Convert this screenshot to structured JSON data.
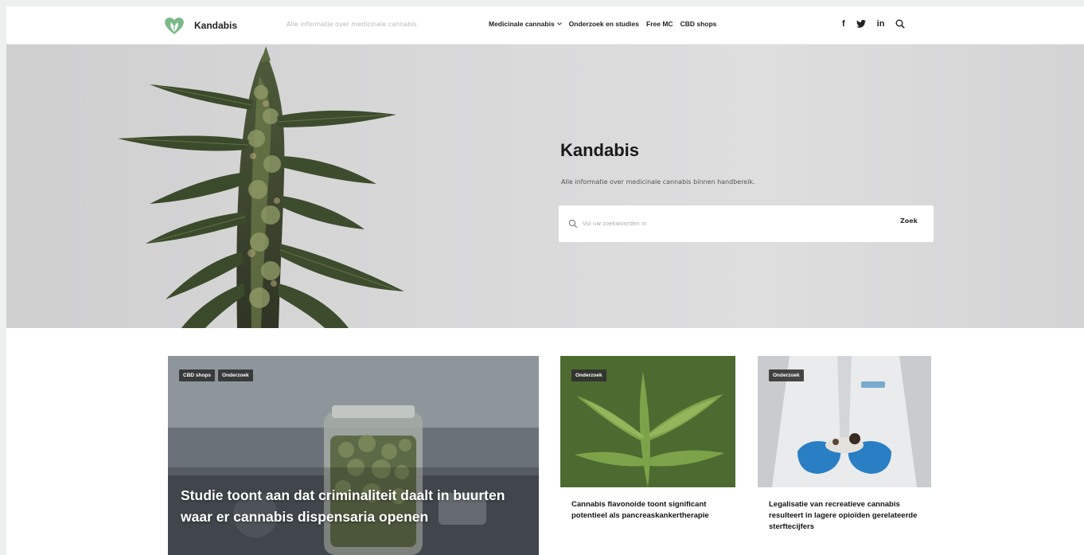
{
  "site": {
    "name": "Kandabis",
    "tagline": "Alle informatie over medicinale cannabis",
    "brand_color": "#6fae7c"
  },
  "nav": {
    "items": [
      {
        "label": "Medicinale cannabis",
        "has_dropdown": true
      },
      {
        "label": "Onderzoek en studies",
        "has_dropdown": false
      },
      {
        "label": "Free MC",
        "has_dropdown": false
      },
      {
        "label": "CBD shops",
        "has_dropdown": false
      }
    ]
  },
  "social": {
    "facebook": "f",
    "linkedin": "in"
  },
  "hero": {
    "title": "Kandabis",
    "subtitle": "Alle informatie over medicinale cannabis binnen handbereik.",
    "search_placeholder": "Vul uw zoekwoorden in",
    "search_button": "Zoek"
  },
  "articles": [
    {
      "tags": [
        "CBD shops",
        "Onderzoek"
      ],
      "title": "Studie toont aan dat criminaliteit daalt in buurten waar er cannabis dispensaria openen"
    },
    {
      "tags": [
        "Onderzoek"
      ],
      "title": "Cannabis flavonoide toont significant potentieel als pancreaskankertherapie"
    },
    {
      "tags": [
        "Onderzoek"
      ],
      "title": "Legalisatie van recreatieve cannabis resulteert in lagere opioïden gerelateerde sterftecijfers"
    }
  ]
}
